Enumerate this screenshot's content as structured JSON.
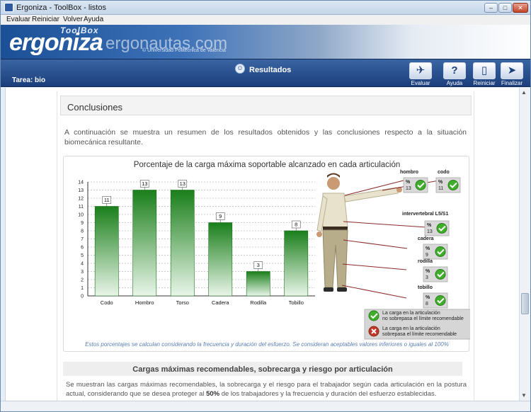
{
  "window": {
    "title": "Ergoniza - ToolBox - listos",
    "controls": {
      "minimize": "–",
      "maximize": "□",
      "close": "✕"
    }
  },
  "menu": [
    "Evaluar",
    "Reiniciar",
    "Volver",
    "Ayuda"
  ],
  "banner": {
    "brand": "ergoniza",
    "toolbox": "ToolBox",
    "site": "ergonautas.com",
    "university": "© Universidad Politécnica de Valencia"
  },
  "toolbar": {
    "task_label": "Tarea: bio",
    "section_title": "Resultados",
    "buttons": [
      {
        "label": "Evaluar",
        "icon": "runner-icon"
      },
      {
        "label": "Ayuda",
        "icon": "help-icon"
      },
      {
        "label": "Reiniciar",
        "icon": "blank-page-icon"
      },
      {
        "label": "Finalizar",
        "icon": "finish-icon"
      }
    ]
  },
  "conclusions": {
    "title": "Conclusiones",
    "intro": "A continuación se muestra un resumen de los resultados obtenidos y las conclusiones respecto a la situación biomecánica resultante."
  },
  "chart_data": {
    "type": "bar",
    "title": "Porcentaje de la carga máxima soportable alcanzado en cada articulación",
    "categories": [
      "Codo",
      "Hombro",
      "Torso",
      "Cadera",
      "Rodilla",
      "Tobillo"
    ],
    "values": [
      11,
      13,
      13,
      9,
      3,
      8
    ],
    "ylim": [
      0,
      14
    ],
    "yticks": [
      0,
      1,
      2,
      3,
      4,
      5,
      6,
      7,
      8,
      9,
      10,
      11,
      12,
      13,
      14
    ],
    "grid": true,
    "bar_color": "#1f8a1f",
    "note": "Estos porcentajes se calculan considerando la frecuencia y duración del esfuerzo. Se consideran aceptables valores inferiores o iguales al 100%"
  },
  "joints": [
    {
      "name": "hombro",
      "pct_symbol": "%",
      "value": "13",
      "status": "ok"
    },
    {
      "name": "codo",
      "pct_symbol": "%",
      "value": "11",
      "status": "ok"
    },
    {
      "name": "intervertebral L5/S1",
      "pct_symbol": "%",
      "value": "13",
      "status": "ok"
    },
    {
      "name": "cadera",
      "pct_symbol": "%",
      "value": "9",
      "status": "ok"
    },
    {
      "name": "rodilla",
      "pct_symbol": "%",
      "value": "3",
      "status": "ok"
    },
    {
      "name": "tobillo",
      "pct_symbol": "%",
      "value": "8",
      "status": "ok"
    }
  ],
  "legend": {
    "ok": [
      "La carga en la articulación",
      "no sobrepasa el límite recomendable"
    ],
    "bad": [
      "La carga en la articulación",
      "sobrepasa el límite recomendable"
    ]
  },
  "colors": {
    "ok": "#3fae2a",
    "bad": "#c0392b",
    "toolbar": "#1c3f7c"
  },
  "loads": {
    "title": "Cargas máximas recomendables, sobrecarga y riesgo por articulación",
    "text_before": "Se muestran las cargas máximas recomendables, la sobrecarga y el riesgo para el trabajador según cada articulación en la postura actual, considerando que se desea proteger al ",
    "percent": "50%",
    "text_after": " de los trabajadores y la frecuencia y duración del esfuerzo establecidas."
  }
}
